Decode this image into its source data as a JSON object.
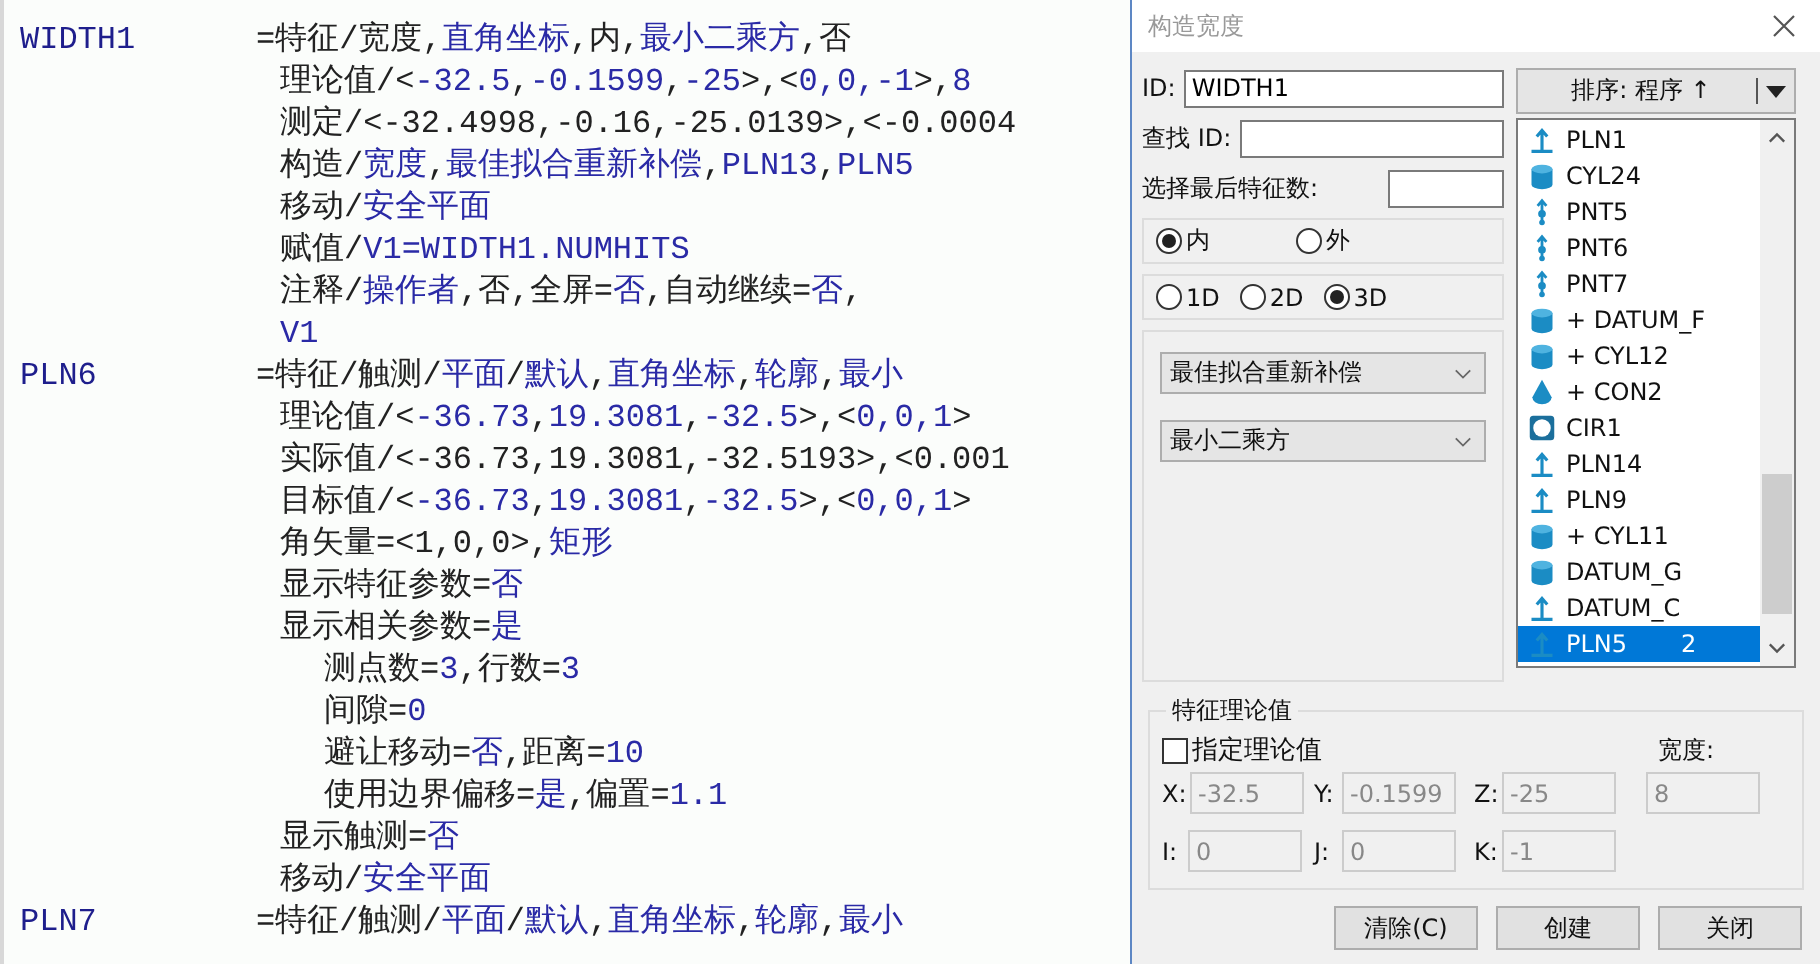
{
  "editor": {
    "blocks": [
      {
        "label": "WIDTH1",
        "parts": [
          {
            "text": "=特征/宽度,",
            "kind": "plain"
          },
          {
            "text": "直角坐标",
            "kind": "value"
          },
          {
            "text": ",内,",
            "kind": "plain"
          },
          {
            "text": "最小二乘方",
            "kind": "value"
          },
          {
            "text": ",否",
            "kind": "plain"
          }
        ],
        "children": [
          {
            "parts": [
              {
                "text": "理论值/<",
                "kind": "plain"
              },
              {
                "text": "-32.5",
                "kind": "value"
              },
              {
                "text": ",",
                "kind": "plain"
              },
              {
                "text": "-0.1599",
                "kind": "value"
              },
              {
                "text": ",",
                "kind": "plain"
              },
              {
                "text": "-25",
                "kind": "value"
              },
              {
                "text": ">,<",
                "kind": "plain"
              },
              {
                "text": "0,0,-1",
                "kind": "value"
              },
              {
                "text": ">,",
                "kind": "plain"
              },
              {
                "text": "8",
                "kind": "value"
              }
            ]
          },
          {
            "parts": [
              {
                "text": "测定/<-32.4998,-0.16,-25.0139>,<-0.0004",
                "kind": "plain"
              }
            ]
          },
          {
            "parts": [
              {
                "text": "构造/",
                "kind": "plain"
              },
              {
                "text": "宽度",
                "kind": "value"
              },
              {
                "text": ",",
                "kind": "plain"
              },
              {
                "text": "最佳拟合重新补偿",
                "kind": "value"
              },
              {
                "text": ",",
                "kind": "plain"
              },
              {
                "text": "PLN13",
                "kind": "value"
              },
              {
                "text": ",",
                "kind": "plain"
              },
              {
                "text": "PLN5",
                "kind": "value"
              }
            ]
          },
          {
            "parts": [
              {
                "text": "移动/",
                "kind": "plain"
              },
              {
                "text": "安全平面",
                "kind": "value"
              }
            ]
          },
          {
            "parts": [
              {
                "text": "赋值/",
                "kind": "plain"
              },
              {
                "text": "V1=WIDTH1.NUMHITS",
                "kind": "value"
              }
            ]
          },
          {
            "parts": [
              {
                "text": "注释/",
                "kind": "plain"
              },
              {
                "text": "操作者",
                "kind": "value"
              },
              {
                "text": ",否,全屏=",
                "kind": "plain"
              },
              {
                "text": "否",
                "kind": "value"
              },
              {
                "text": ",自动继续=",
                "kind": "plain"
              },
              {
                "text": "否",
                "kind": "value"
              },
              {
                "text": ",",
                "kind": "plain"
              }
            ]
          },
          {
            "parts": [
              {
                "text": "V1",
                "kind": "value"
              }
            ]
          }
        ]
      },
      {
        "label": "PLN6",
        "parts": [
          {
            "text": "=特征/触测/",
            "kind": "plain"
          },
          {
            "text": "平面",
            "kind": "value"
          },
          {
            "text": "/",
            "kind": "plain"
          },
          {
            "text": "默认",
            "kind": "value"
          },
          {
            "text": ",",
            "kind": "plain"
          },
          {
            "text": "直角坐标",
            "kind": "value"
          },
          {
            "text": ",",
            "kind": "plain"
          },
          {
            "text": "轮廓",
            "kind": "value"
          },
          {
            "text": ",",
            "kind": "plain"
          },
          {
            "text": "最小",
            "kind": "value"
          }
        ],
        "children": [
          {
            "parts": [
              {
                "text": "理论值/<",
                "kind": "plain"
              },
              {
                "text": "-36.73",
                "kind": "value"
              },
              {
                "text": ",",
                "kind": "plain"
              },
              {
                "text": "19.3081",
                "kind": "value"
              },
              {
                "text": ",",
                "kind": "plain"
              },
              {
                "text": "-32.5",
                "kind": "value"
              },
              {
                "text": ">,<",
                "kind": "plain"
              },
              {
                "text": "0,0,1",
                "kind": "value"
              },
              {
                "text": ">",
                "kind": "plain"
              }
            ]
          },
          {
            "parts": [
              {
                "text": "实际值/<-36.73,19.3081,-32.5193>,<0.001",
                "kind": "plain"
              }
            ]
          },
          {
            "parts": [
              {
                "text": "目标值/<",
                "kind": "plain"
              },
              {
                "text": "-36.73",
                "kind": "value"
              },
              {
                "text": ",",
                "kind": "plain"
              },
              {
                "text": "19.3081",
                "kind": "value"
              },
              {
                "text": ",",
                "kind": "plain"
              },
              {
                "text": "-32.5",
                "kind": "value"
              },
              {
                "text": ">,<",
                "kind": "plain"
              },
              {
                "text": "0,0,1",
                "kind": "value"
              },
              {
                "text": ">",
                "kind": "plain"
              }
            ]
          },
          {
            "parts": [
              {
                "text": "角矢量=<1,0,0>,",
                "kind": "plain"
              },
              {
                "text": "矩形",
                "kind": "value"
              }
            ]
          },
          {
            "parts": [
              {
                "text": "显示特征参数=",
                "kind": "plain"
              },
              {
                "text": "否",
                "kind": "value"
              }
            ]
          },
          {
            "parts": [
              {
                "text": "显示相关参数=",
                "kind": "plain"
              },
              {
                "text": "是",
                "kind": "value"
              }
            ],
            "children": [
              {
                "parts": [
                  {
                    "text": "测点数=",
                    "kind": "plain"
                  },
                  {
                    "text": "3",
                    "kind": "value"
                  },
                  {
                    "text": ",行数=",
                    "kind": "plain"
                  },
                  {
                    "text": "3",
                    "kind": "value"
                  }
                ]
              },
              {
                "parts": [
                  {
                    "text": "间隙=",
                    "kind": "plain"
                  },
                  {
                    "text": "0",
                    "kind": "value"
                  }
                ]
              },
              {
                "parts": [
                  {
                    "text": "避让移动=",
                    "kind": "plain"
                  },
                  {
                    "text": "否",
                    "kind": "value"
                  },
                  {
                    "text": ",距离=",
                    "kind": "plain"
                  },
                  {
                    "text": "10",
                    "kind": "value"
                  }
                ]
              },
              {
                "parts": [
                  {
                    "text": "使用边界偏移=",
                    "kind": "plain"
                  },
                  {
                    "text": "是",
                    "kind": "value"
                  },
                  {
                    "text": ",偏置=",
                    "kind": "plain"
                  },
                  {
                    "text": "1.1",
                    "kind": "value"
                  }
                ]
              }
            ]
          },
          {
            "parts": [
              {
                "text": "显示触测=",
                "kind": "plain"
              },
              {
                "text": "否",
                "kind": "value"
              }
            ]
          },
          {
            "parts": [
              {
                "text": "移动/",
                "kind": "plain"
              },
              {
                "text": "安全平面",
                "kind": "value"
              }
            ]
          }
        ]
      },
      {
        "label": "PLN7",
        "parts": [
          {
            "text": "=特征/触测/",
            "kind": "plain"
          },
          {
            "text": "平面",
            "kind": "value"
          },
          {
            "text": "/",
            "kind": "plain"
          },
          {
            "text": "默认",
            "kind": "value"
          },
          {
            "text": ",",
            "kind": "plain"
          },
          {
            "text": "直角坐标",
            "kind": "value"
          },
          {
            "text": ",",
            "kind": "plain"
          },
          {
            "text": "轮廓",
            "kind": "value"
          },
          {
            "text": ",",
            "kind": "plain"
          },
          {
            "text": "最小",
            "kind": "value"
          }
        ]
      }
    ]
  },
  "dialog": {
    "title": "构造宽度",
    "id_label": "ID:",
    "id_value": "WIDTH1",
    "find_label": "查找 ID:",
    "last_label": "选择最后特征数:",
    "direction": [
      {
        "label": "内",
        "selected": true
      },
      {
        "label": "外",
        "selected": false
      }
    ],
    "dimension": [
      {
        "label": "1D",
        "selected": false
      },
      {
        "label": "2D",
        "selected": false
      },
      {
        "label": "3D",
        "selected": true
      }
    ],
    "dropdowns": [
      "最佳拟合重新补偿",
      "最小二乘方"
    ],
    "sort_button": "排序: 程序 ↑",
    "features": [
      {
        "label": "PLN1",
        "kind": "plane",
        "selected": false
      },
      {
        "label": "CYL24",
        "kind": "cylinder",
        "selected": false
      },
      {
        "label": "PNT5",
        "kind": "point",
        "selected": false
      },
      {
        "label": "PNT6",
        "kind": "point",
        "selected": false
      },
      {
        "label": "PNT7",
        "kind": "point",
        "selected": false
      },
      {
        "label": "+ DATUM_F",
        "kind": "cylinder",
        "selected": false
      },
      {
        "label": "+ CYL12",
        "kind": "cylinder",
        "selected": false
      },
      {
        "label": "+ CON2",
        "kind": "cone",
        "selected": false
      },
      {
        "label": "CIR1",
        "kind": "circle",
        "selected": false
      },
      {
        "label": "PLN14",
        "kind": "plane",
        "selected": false
      },
      {
        "label": "PLN9",
        "kind": "plane",
        "selected": false
      },
      {
        "label": "+ CYL11",
        "kind": "cylinder",
        "selected": false
      },
      {
        "label": "DATUM_G",
        "kind": "cylinder",
        "selected": false
      },
      {
        "label": "DATUM_C",
        "kind": "plane",
        "selected": false
      },
      {
        "label": "PLN5",
        "kind": "plane",
        "selected": true,
        "count": "2"
      }
    ],
    "theoretical": {
      "title": "特征理论值",
      "specify": {
        "label": "指定理论值",
        "checked": false
      },
      "width_label": "宽度:",
      "fields": [
        {
          "label": "X:",
          "value": "-32.5",
          "disabled": true
        },
        {
          "label": "Y:",
          "value": "-0.1599",
          "disabled": true
        },
        {
          "label": "Z:",
          "value": "-25",
          "disabled": true
        },
        {
          "value": "8",
          "disabled": true
        },
        {
          "label": "I:",
          "value": "0",
          "disabled": true
        },
        {
          "label": "J:",
          "value": "0",
          "disabled": true
        },
        {
          "label": "K:",
          "value": "-1",
          "disabled": true
        }
      ]
    },
    "buttons": [
      "清除(C)",
      "创建",
      "关闭"
    ]
  }
}
